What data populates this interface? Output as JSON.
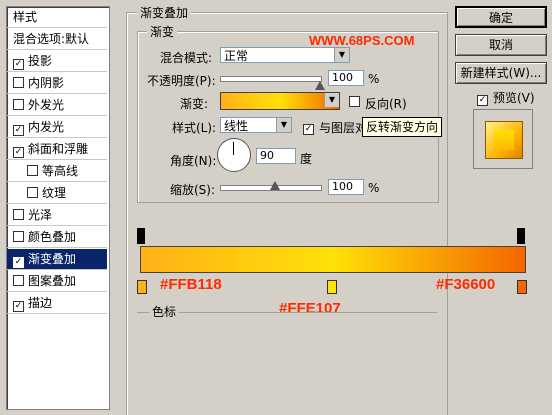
{
  "stylelist": {
    "header": "样式",
    "blend_default": "混合选项:默认",
    "items": [
      {
        "label": "投影",
        "checked": true
      },
      {
        "label": "内阴影",
        "checked": false
      },
      {
        "label": "外发光",
        "checked": false
      },
      {
        "label": "内发光",
        "checked": true
      },
      {
        "label": "斜面和浮雕",
        "checked": true
      },
      {
        "label": "等高线",
        "checked": false
      },
      {
        "label": "纹理",
        "checked": false
      },
      {
        "label": "光泽",
        "checked": false
      },
      {
        "label": "颜色叠加",
        "checked": false
      },
      {
        "label": "渐变叠加",
        "checked": true
      },
      {
        "label": "图案叠加",
        "checked": false
      },
      {
        "label": "描边",
        "checked": true
      }
    ],
    "check_mark": "✓"
  },
  "panel": {
    "title": "渐变叠加",
    "group": "渐变",
    "blend_mode_label": "混合模式:",
    "blend_mode_value": "正常",
    "opacity_label": "不透明度(P):",
    "opacity_value": "100",
    "percent": "%",
    "gradient_label": "渐变:",
    "reverse_label": "反向(R)",
    "style_label": "样式(L):",
    "style_value": "线性",
    "align_label": "与图层对",
    "angle_label": "角度(N):",
    "angle_value": "90",
    "degree": "度",
    "scale_label": "缩放(S):",
    "scale_value": "100",
    "tooltip": "反转渐变方向",
    "colorstop_label": "色标",
    "opacity_level": 1.0,
    "scale_level": 0.55
  },
  "buttons": {
    "ok": "确定",
    "cancel": "取消",
    "new_style": "新建样式(W)...",
    "preview": "预览(V)"
  },
  "watermarks": {
    "site": "WWW.68PS.COM",
    "left_color": "#FFB118",
    "mid_color": "#FFE107",
    "right_color": "#F36600"
  },
  "colors": {
    "stop_left": "#ffb118",
    "stop_mid": "#ffe107",
    "stop_right": "#f36600",
    "selection": "#0a246a",
    "watermark": "#ff2a00"
  }
}
